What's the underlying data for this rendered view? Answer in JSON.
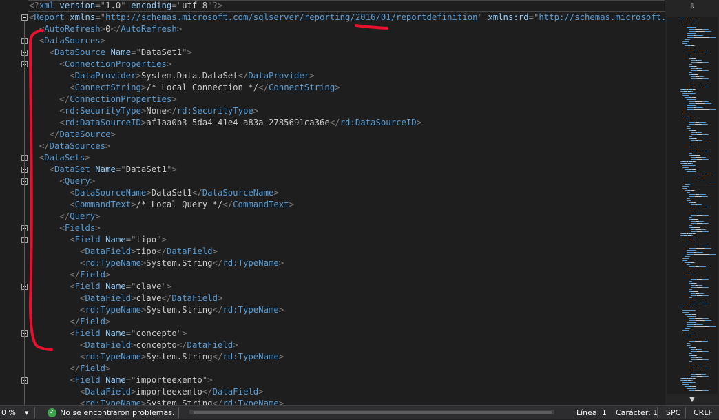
{
  "editor": {
    "lines": [
      {
        "fold": false,
        "indent": 0,
        "tokens": [
          [
            "d",
            "<?"
          ],
          [
            "t",
            "xml"
          ],
          [
            "an",
            " version"
          ],
          [
            "d",
            "=\""
          ],
          [
            "av",
            "1.0"
          ],
          [
            "d",
            "\""
          ],
          [
            "an",
            " encoding"
          ],
          [
            "d",
            "=\""
          ],
          [
            "av",
            "utf-8"
          ],
          [
            "d",
            "\"?>"
          ]
        ]
      },
      {
        "fold": true,
        "indent": 0,
        "tokens": [
          [
            "d",
            "<"
          ],
          [
            "t",
            "Report"
          ],
          [
            "an",
            " xmlns"
          ],
          [
            "d",
            "=\""
          ],
          [
            "ln",
            "http://schemas.microsoft.com/sqlserver/reporting/2016/01/reportdefinition"
          ],
          [
            "d",
            "\""
          ],
          [
            "an",
            " xmlns:rd"
          ],
          [
            "d",
            "=\""
          ],
          [
            "ln",
            "http://schemas.microsoft.com/SQLServer/reporting/reportdesigner"
          ],
          [
            "d",
            "\">"
          ]
        ]
      },
      {
        "fold": false,
        "indent": 1,
        "tokens": [
          [
            "d",
            "<"
          ],
          [
            "t",
            "AutoRefresh"
          ],
          [
            "d",
            ">"
          ],
          [
            "av",
            "0"
          ],
          [
            "d",
            "</"
          ],
          [
            "t",
            "AutoRefresh"
          ],
          [
            "d",
            ">"
          ]
        ]
      },
      {
        "fold": true,
        "indent": 1,
        "tokens": [
          [
            "d",
            "<"
          ],
          [
            "t",
            "DataSources"
          ],
          [
            "d",
            ">"
          ]
        ]
      },
      {
        "fold": true,
        "indent": 2,
        "tokens": [
          [
            "d",
            "<"
          ],
          [
            "t",
            "DataSource"
          ],
          [
            "an",
            " Name"
          ],
          [
            "d",
            "=\""
          ],
          [
            "av",
            "DataSet1"
          ],
          [
            "d",
            "\">"
          ]
        ]
      },
      {
        "fold": true,
        "indent": 3,
        "tokens": [
          [
            "d",
            "<"
          ],
          [
            "t",
            "ConnectionProperties"
          ],
          [
            "d",
            ">"
          ]
        ]
      },
      {
        "fold": false,
        "indent": 4,
        "tokens": [
          [
            "d",
            "<"
          ],
          [
            "t",
            "DataProvider"
          ],
          [
            "d",
            ">"
          ],
          [
            "av",
            "System.Data.DataSet"
          ],
          [
            "d",
            "</"
          ],
          [
            "t",
            "DataProvider"
          ],
          [
            "d",
            ">"
          ]
        ]
      },
      {
        "fold": false,
        "indent": 4,
        "tokens": [
          [
            "d",
            "<"
          ],
          [
            "t",
            "ConnectString"
          ],
          [
            "d",
            ">"
          ],
          [
            "av",
            "/* Local Connection */"
          ],
          [
            "d",
            "</"
          ],
          [
            "t",
            "ConnectString"
          ],
          [
            "d",
            ">"
          ]
        ]
      },
      {
        "fold": false,
        "indent": 3,
        "tokens": [
          [
            "d",
            "</"
          ],
          [
            "t",
            "ConnectionProperties"
          ],
          [
            "d",
            ">"
          ]
        ]
      },
      {
        "fold": false,
        "indent": 3,
        "tokens": [
          [
            "d",
            "<"
          ],
          [
            "t",
            "rd:SecurityType"
          ],
          [
            "d",
            ">"
          ],
          [
            "av",
            "None"
          ],
          [
            "d",
            "</"
          ],
          [
            "t",
            "rd:SecurityType"
          ],
          [
            "d",
            ">"
          ]
        ]
      },
      {
        "fold": false,
        "indent": 3,
        "tokens": [
          [
            "d",
            "<"
          ],
          [
            "t",
            "rd:DataSourceID"
          ],
          [
            "d",
            ">"
          ],
          [
            "av",
            "af1aa0b3-5da4-41e4-a83a-2785691ca36e"
          ],
          [
            "d",
            "</"
          ],
          [
            "t",
            "rd:DataSourceID"
          ],
          [
            "d",
            ">"
          ]
        ]
      },
      {
        "fold": false,
        "indent": 2,
        "tokens": [
          [
            "d",
            "</"
          ],
          [
            "t",
            "DataSource"
          ],
          [
            "d",
            ">"
          ]
        ]
      },
      {
        "fold": false,
        "indent": 1,
        "tokens": [
          [
            "d",
            "</"
          ],
          [
            "t",
            "DataSources"
          ],
          [
            "d",
            ">"
          ]
        ]
      },
      {
        "fold": true,
        "indent": 1,
        "tokens": [
          [
            "d",
            "<"
          ],
          [
            "t",
            "DataSets"
          ],
          [
            "d",
            ">"
          ]
        ]
      },
      {
        "fold": true,
        "indent": 2,
        "tokens": [
          [
            "d",
            "<"
          ],
          [
            "t",
            "DataSet"
          ],
          [
            "an",
            " Name"
          ],
          [
            "d",
            "=\""
          ],
          [
            "av",
            "DataSet1"
          ],
          [
            "d",
            "\">"
          ]
        ]
      },
      {
        "fold": true,
        "indent": 3,
        "tokens": [
          [
            "d",
            "<"
          ],
          [
            "t",
            "Query"
          ],
          [
            "d",
            ">"
          ]
        ]
      },
      {
        "fold": false,
        "indent": 4,
        "tokens": [
          [
            "d",
            "<"
          ],
          [
            "t",
            "DataSourceName"
          ],
          [
            "d",
            ">"
          ],
          [
            "av",
            "DataSet1"
          ],
          [
            "d",
            "</"
          ],
          [
            "t",
            "DataSourceName"
          ],
          [
            "d",
            ">"
          ]
        ]
      },
      {
        "fold": false,
        "indent": 4,
        "tokens": [
          [
            "d",
            "<"
          ],
          [
            "t",
            "CommandText"
          ],
          [
            "d",
            ">"
          ],
          [
            "av",
            "/* Local Query */"
          ],
          [
            "d",
            "</"
          ],
          [
            "t",
            "CommandText"
          ],
          [
            "d",
            ">"
          ]
        ]
      },
      {
        "fold": false,
        "indent": 3,
        "tokens": [
          [
            "d",
            "</"
          ],
          [
            "t",
            "Query"
          ],
          [
            "d",
            ">"
          ]
        ]
      },
      {
        "fold": true,
        "indent": 3,
        "tokens": [
          [
            "d",
            "<"
          ],
          [
            "t",
            "Fields"
          ],
          [
            "d",
            ">"
          ]
        ]
      },
      {
        "fold": true,
        "indent": 4,
        "tokens": [
          [
            "d",
            "<"
          ],
          [
            "t",
            "Field"
          ],
          [
            "an",
            " Name"
          ],
          [
            "d",
            "=\""
          ],
          [
            "av",
            "tipo"
          ],
          [
            "d",
            "\">"
          ]
        ]
      },
      {
        "fold": false,
        "indent": 5,
        "tokens": [
          [
            "d",
            "<"
          ],
          [
            "t",
            "DataField"
          ],
          [
            "d",
            ">"
          ],
          [
            "av",
            "tipo"
          ],
          [
            "d",
            "</"
          ],
          [
            "t",
            "DataField"
          ],
          [
            "d",
            ">"
          ]
        ]
      },
      {
        "fold": false,
        "indent": 5,
        "tokens": [
          [
            "d",
            "<"
          ],
          [
            "t",
            "rd:TypeName"
          ],
          [
            "d",
            ">"
          ],
          [
            "av",
            "System.String"
          ],
          [
            "d",
            "</"
          ],
          [
            "t",
            "rd:TypeName"
          ],
          [
            "d",
            ">"
          ]
        ]
      },
      {
        "fold": false,
        "indent": 4,
        "tokens": [
          [
            "d",
            "</"
          ],
          [
            "t",
            "Field"
          ],
          [
            "d",
            ">"
          ]
        ]
      },
      {
        "fold": true,
        "indent": 4,
        "tokens": [
          [
            "d",
            "<"
          ],
          [
            "t",
            "Field"
          ],
          [
            "an",
            " Name"
          ],
          [
            "d",
            "=\""
          ],
          [
            "av",
            "clave"
          ],
          [
            "d",
            "\">"
          ]
        ]
      },
      {
        "fold": false,
        "indent": 5,
        "tokens": [
          [
            "d",
            "<"
          ],
          [
            "t",
            "DataField"
          ],
          [
            "d",
            ">"
          ],
          [
            "av",
            "clave"
          ],
          [
            "d",
            "</"
          ],
          [
            "t",
            "DataField"
          ],
          [
            "d",
            ">"
          ]
        ]
      },
      {
        "fold": false,
        "indent": 5,
        "tokens": [
          [
            "d",
            "<"
          ],
          [
            "t",
            "rd:TypeName"
          ],
          [
            "d",
            ">"
          ],
          [
            "av",
            "System.String"
          ],
          [
            "d",
            "</"
          ],
          [
            "t",
            "rd:TypeName"
          ],
          [
            "d",
            ">"
          ]
        ]
      },
      {
        "fold": false,
        "indent": 4,
        "tokens": [
          [
            "d",
            "</"
          ],
          [
            "t",
            "Field"
          ],
          [
            "d",
            ">"
          ]
        ]
      },
      {
        "fold": true,
        "indent": 4,
        "tokens": [
          [
            "d",
            "<"
          ],
          [
            "t",
            "Field"
          ],
          [
            "an",
            " Name"
          ],
          [
            "d",
            "=\""
          ],
          [
            "av",
            "concepto"
          ],
          [
            "d",
            "\">"
          ]
        ]
      },
      {
        "fold": false,
        "indent": 5,
        "tokens": [
          [
            "d",
            "<"
          ],
          [
            "t",
            "DataField"
          ],
          [
            "d",
            ">"
          ],
          [
            "av",
            "concepto"
          ],
          [
            "d",
            "</"
          ],
          [
            "t",
            "DataField"
          ],
          [
            "d",
            ">"
          ]
        ]
      },
      {
        "fold": false,
        "indent": 5,
        "tokens": [
          [
            "d",
            "<"
          ],
          [
            "t",
            "rd:TypeName"
          ],
          [
            "d",
            ">"
          ],
          [
            "av",
            "System.String"
          ],
          [
            "d",
            "</"
          ],
          [
            "t",
            "rd:TypeName"
          ],
          [
            "d",
            ">"
          ]
        ]
      },
      {
        "fold": false,
        "indent": 4,
        "tokens": [
          [
            "d",
            "</"
          ],
          [
            "t",
            "Field"
          ],
          [
            "d",
            ">"
          ]
        ]
      },
      {
        "fold": true,
        "indent": 4,
        "tokens": [
          [
            "d",
            "<"
          ],
          [
            "t",
            "Field"
          ],
          [
            "an",
            " Name"
          ],
          [
            "d",
            "=\""
          ],
          [
            "av",
            "importeexento"
          ],
          [
            "d",
            "\">"
          ]
        ]
      },
      {
        "fold": false,
        "indent": 5,
        "tokens": [
          [
            "d",
            "<"
          ],
          [
            "t",
            "DataField"
          ],
          [
            "d",
            ">"
          ],
          [
            "av",
            "importeexento"
          ],
          [
            "d",
            "</"
          ],
          [
            "t",
            "DataField"
          ],
          [
            "d",
            ">"
          ]
        ]
      },
      {
        "fold": false,
        "indent": 5,
        "tokens": [
          [
            "d",
            "<"
          ],
          [
            "t",
            "rd:TypeName"
          ],
          [
            "d",
            ">"
          ],
          [
            "av",
            "System.String"
          ],
          [
            "d",
            "</"
          ],
          [
            "t",
            "rd:TypeName"
          ],
          [
            "d",
            ">"
          ]
        ]
      }
    ]
  },
  "colors": {
    "tag": "#569cd6",
    "attr_name": "#92caf4",
    "attr_value": "#c8c8c8",
    "delimiter": "#808080",
    "text": "#dcdcdc",
    "annotation": "#e8112d"
  },
  "minimap": {
    "up_icon": "▲",
    "down_icon": "▼",
    "split_icon": "⇩"
  },
  "status": {
    "zoom": "0 %",
    "zoom_arrow": "▾",
    "issues": "No se encontraron problemas.",
    "line": "Línea: 1",
    "char": "Carácter: 1",
    "spacing": "SPC",
    "eol": "CRLF"
  }
}
